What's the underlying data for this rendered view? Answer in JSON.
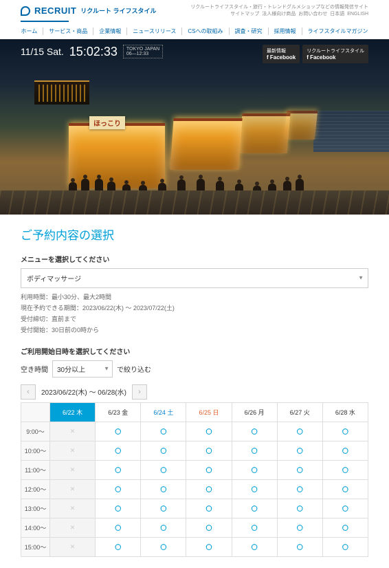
{
  "header": {
    "logo_main": "RECRUIT",
    "logo_sub": "リクルート ライフスタイル",
    "tiny_line1": "リクルートライフスタイル・旅行・トレンドグルメショップなどの情報発信サイト",
    "tiny_links": [
      "サイトマップ",
      "法人様向け商品",
      "お問い合わせ",
      "日本語",
      "ENGLISH"
    ],
    "nav": [
      "ホーム",
      "サービス・商品",
      "企業情報",
      "ニュースリリース",
      "CSへの取組み",
      "調査・研究",
      "採用情報",
      "ライフスタイルマガジン"
    ]
  },
  "hero": {
    "date": "11/15 Sat.",
    "time": "15:02:33",
    "location": "TOKYO JAPAN",
    "sub": "06—12:33",
    "fb1_top": "最新情報",
    "fb1_label": "Facebook",
    "fb2_top": "リクルートライフスタイル",
    "fb2_label": "Facebook",
    "sign1": "ほっこり"
  },
  "booking": {
    "title": "ご予約内容の選択",
    "menu_label": "メニューを選択してください",
    "menu_value": "ボディマッサージ",
    "info": [
      "利用時間：最小30分、最大2時間",
      "現在予約できる期間：2023/06/22(木) ～ 2023/07/22(土)",
      "受付締切：直前まで",
      "受付開始：30日前の0時から"
    ],
    "datetime_label": "ご利用開始日時を選択してください",
    "filter_label": "空き時間",
    "filter_value": "30分以上",
    "filter_suffix": "で絞り込む",
    "date_range": "2023/06/22(木) ～ 06/28(水)",
    "days": [
      {
        "label": "6/22 木",
        "cls": "sel"
      },
      {
        "label": "6/23 金",
        "cls": ""
      },
      {
        "label": "6/24 土",
        "cls": "sat"
      },
      {
        "label": "6/25 日",
        "cls": "sun"
      },
      {
        "label": "6/26 月",
        "cls": ""
      },
      {
        "label": "6/27 火",
        "cls": ""
      },
      {
        "label": "6/28 水",
        "cls": ""
      }
    ],
    "times": [
      "9:00～",
      "10:00～",
      "11:00～",
      "12:00～",
      "13:00～",
      "14:00～",
      "15:00～"
    ],
    "slots": [
      [
        "x",
        "o",
        "o",
        "o",
        "o",
        "o",
        "o"
      ],
      [
        "x",
        "o",
        "o",
        "o",
        "o",
        "o",
        "o"
      ],
      [
        "x",
        "o",
        "o",
        "o",
        "o",
        "o",
        "o"
      ],
      [
        "x",
        "o",
        "o",
        "o",
        "o",
        "o",
        "o"
      ],
      [
        "x",
        "o",
        "o",
        "o",
        "o",
        "o",
        "o"
      ],
      [
        "x",
        "o",
        "o",
        "o",
        "o",
        "o",
        "o"
      ],
      [
        "x",
        "o",
        "o",
        "o",
        "o",
        "o",
        "o"
      ]
    ]
  }
}
